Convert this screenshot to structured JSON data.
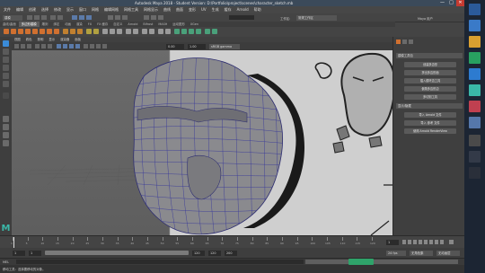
{
  "window": {
    "title": "Autodesk Maya 2018 - Student Version: D:\\Portfolio\\project\\scenes\\character_sketch.mb",
    "min_label": "—",
    "max_label": "□",
    "close_label": "✕"
  },
  "menubar": [
    "文件",
    "编辑",
    "创建",
    "选择",
    "修改",
    "显示",
    "窗口",
    "网格",
    "编辑网格",
    "网格工具",
    "网格显示",
    "曲线",
    "曲面",
    "变形",
    "UV",
    "生成",
    "缓存",
    "Arnold",
    "帮助"
  ],
  "statusline": {
    "mode": "建模",
    "workspace_label": "工作区:",
    "workspace_value": "常规工作区",
    "username": "Maya 用户"
  },
  "shelf_tabs": [
    {
      "label": "曲线/曲面",
      "active": false
    },
    {
      "label": "多边形建模",
      "active": true
    },
    {
      "label": "雕刻",
      "active": false
    },
    {
      "label": "绑定",
      "active": false
    },
    {
      "label": "动画",
      "active": false
    },
    {
      "label": "渲染",
      "active": false
    },
    {
      "label": "FX",
      "active": false
    },
    {
      "label": "FX 缓存",
      "active": false
    },
    {
      "label": "自定义",
      "active": false
    },
    {
      "label": "Arnold",
      "active": false
    },
    {
      "label": "Bifrost",
      "active": false
    },
    {
      "label": "MASH",
      "active": false
    },
    {
      "label": "运动图形",
      "active": false
    },
    {
      "label": "XGen",
      "active": false
    }
  ],
  "panel_menu": [
    "视图",
    "着色",
    "照明",
    "显示",
    "渲染器",
    "面板"
  ],
  "panel_fields": {
    "near_value": "0.00",
    "far_value": "1.00",
    "colorspace": "sRGB gamma"
  },
  "side_panel": {
    "header1": "建模工具包",
    "buttons1": [
      "创建多边形",
      "挤出多边形面",
      "插入循环边工具",
      "倒角多边形边",
      "多切割工具"
    ],
    "header2": "显示/隐藏",
    "buttons2": [
      "导入 Arnold 文件",
      "导入 参考 文件",
      "使用 Arnold RenderView"
    ]
  },
  "time_slider": {
    "ticks": [
      "1",
      "5",
      "10",
      "15",
      "20",
      "25",
      "30",
      "35",
      "40",
      "45",
      "50",
      "55",
      "60",
      "65",
      "70",
      "75",
      "80",
      "85",
      "90",
      "95",
      "100",
      "105",
      "110",
      "115",
      "120"
    ],
    "current_frame": "1"
  },
  "range_slider": {
    "start": "1",
    "start_inner": "1",
    "end_inner": "120",
    "end": "120",
    "end2": "200",
    "fps": "24 fps",
    "char_set": "无角色集",
    "anim_layer": "无动画层"
  },
  "cmdline": {
    "lang": "MEL"
  },
  "help": {
    "text": "移动工具：选择要移动的对象。"
  },
  "colors": {
    "viewport_bg": "#6f6f6f",
    "accent": "#3a8bd8",
    "mesh_wire": "#3a3a9a",
    "mesh_fill": "#8a8a8e"
  }
}
